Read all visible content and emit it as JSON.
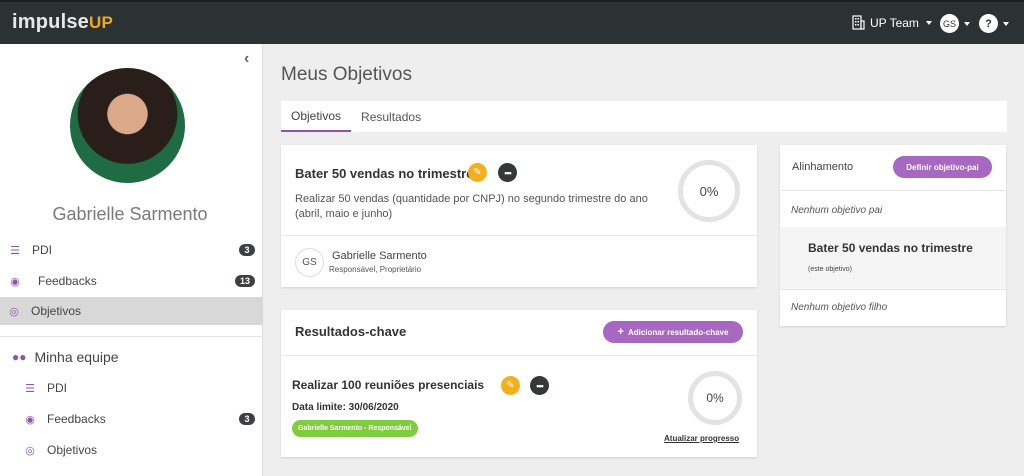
{
  "topbar": {
    "logo_main": "impulse",
    "logo_accent": "UP",
    "team_label": "UP Team",
    "user_initials": "GS",
    "help_label": "?"
  },
  "sidebar": {
    "user_name": "Gabrielle Sarmento",
    "items": [
      {
        "label": "PDI",
        "badge": "3"
      },
      {
        "label": "Feedbacks",
        "badge": "13"
      },
      {
        "label": "Objetivos",
        "badge": ""
      }
    ],
    "team_header": "Minha equipe",
    "team_items": [
      {
        "label": "PDI",
        "badge": ""
      },
      {
        "label": "Feedbacks",
        "badge": "3"
      },
      {
        "label": "Objetivos",
        "badge": ""
      }
    ]
  },
  "main": {
    "title": "Meus Objetivos",
    "tabs": [
      {
        "label": "Objetivos",
        "active": true
      },
      {
        "label": "Resultados",
        "active": false
      }
    ]
  },
  "objective": {
    "title": "Bater 50 vendas no trimestre",
    "description": "Realizar 50 vendas (quantidade por CNPJ) no segundo trimestre do ano (abril, maio e junho)",
    "progress": "0%",
    "owner_initials": "GS",
    "owner_name": "Gabrielle Sarmento",
    "owner_role": "Responsável, Proprietário"
  },
  "key_results": {
    "header": "Resultados-chave",
    "add_button": "Adicionar resultado-chave",
    "items": [
      {
        "title": "Realizar 100 reuniões presenciais",
        "deadline": "Data limite: 30/06/2020",
        "owner_tag": "Gabrielle Sarmento - Responsável",
        "progress": "0%",
        "update_link": "Atualizar progresso"
      }
    ]
  },
  "alignment": {
    "label": "Alinhamento",
    "define_parent_button": "Definir objetivo-pai",
    "no_parent": "Nenhum objetivo pai",
    "current_title": "Bater 50 vendas no trimestre",
    "current_sub": "(este objetivo)",
    "no_child": "Nenhum objetivo filho"
  },
  "colors": {
    "topbar": "#2c3133",
    "accent_purple": "#a768c2",
    "accent_yellow": "#f2b01e",
    "tag_green": "#7fcc3f"
  }
}
